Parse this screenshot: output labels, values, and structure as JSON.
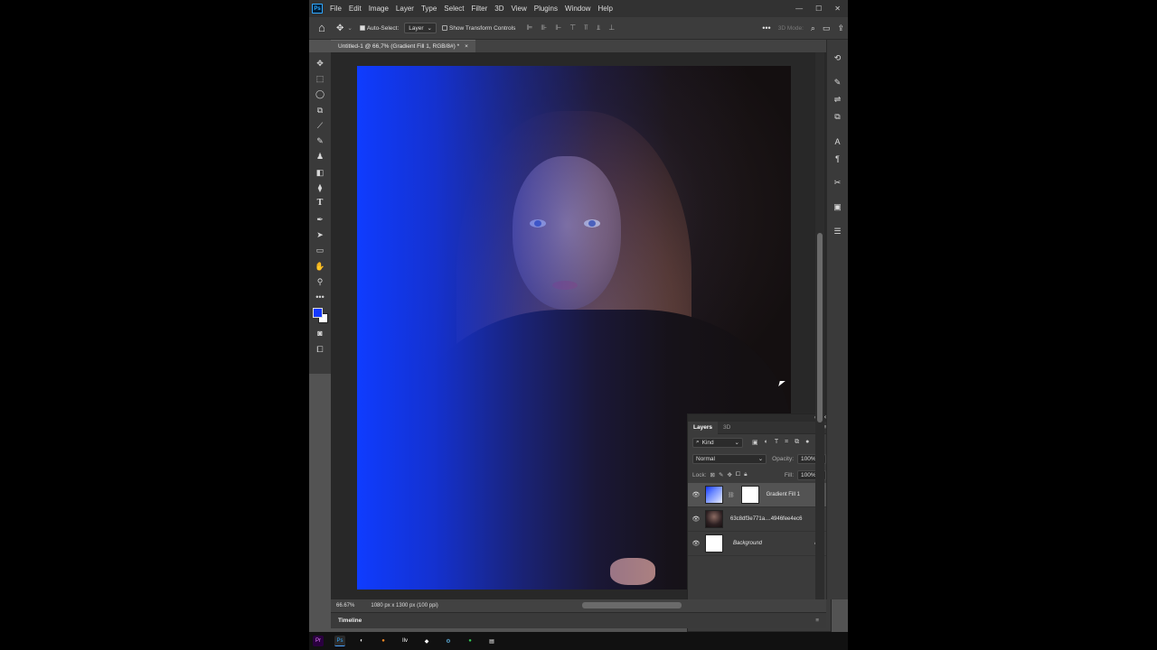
{
  "app": {
    "name": "Ps"
  },
  "menu": [
    "File",
    "Edit",
    "Image",
    "Layer",
    "Type",
    "Select",
    "Filter",
    "3D",
    "View",
    "Plugins",
    "Window",
    "Help"
  ],
  "window_controls": [
    "—",
    "☐",
    "✕"
  ],
  "options": {
    "auto_select_label": "Auto-Select:",
    "auto_select_value": "Layer",
    "show_transform": "Show Transform Controls",
    "mode3d": "3D Mode:"
  },
  "document": {
    "tab_title": "Untitled-1 @ 66,7% (Gradient Fill 1, RGB/8#) *",
    "tab_close": "×"
  },
  "colors": {
    "foreground": "#1439ff",
    "background": "#ffffff"
  },
  "tools": [
    "move-icon",
    "marquee-icon",
    "lasso-icon",
    "object-select-icon",
    "eyedropper-icon",
    "brush-icon",
    "stamp-icon",
    "eraser-icon",
    "paint-bucket-icon",
    "type-icon",
    "pen-icon",
    "path-select-icon",
    "rectangle-icon",
    "hand-icon",
    "zoom-icon",
    "more-icon"
  ],
  "layers_panel": {
    "tabs": [
      "Layers",
      "3D"
    ],
    "kind": "Kind",
    "blend_mode": "Normal",
    "opacity_label": "Opacity:",
    "opacity_value": "100%",
    "lock_label": "Lock:",
    "fill_label": "Fill:",
    "fill_value": "100%",
    "layers": [
      {
        "name": "Gradient Fill 1",
        "selected": true,
        "visible": true
      },
      {
        "name": "63c8df3e771a....4946fee4ec6",
        "selected": false,
        "visible": true
      },
      {
        "name": "Background",
        "selected": false,
        "visible": true,
        "locked": true
      }
    ]
  },
  "status": {
    "zoom": "66.67%",
    "doc_size": "1080 px x 1300 px (100 ppi)"
  },
  "timeline": {
    "label": "Timeline"
  },
  "taskbar": [
    "Pr",
    "Ps",
    "◐",
    "●",
    "Ilv",
    "◆",
    "⚙",
    "●",
    "▤"
  ]
}
